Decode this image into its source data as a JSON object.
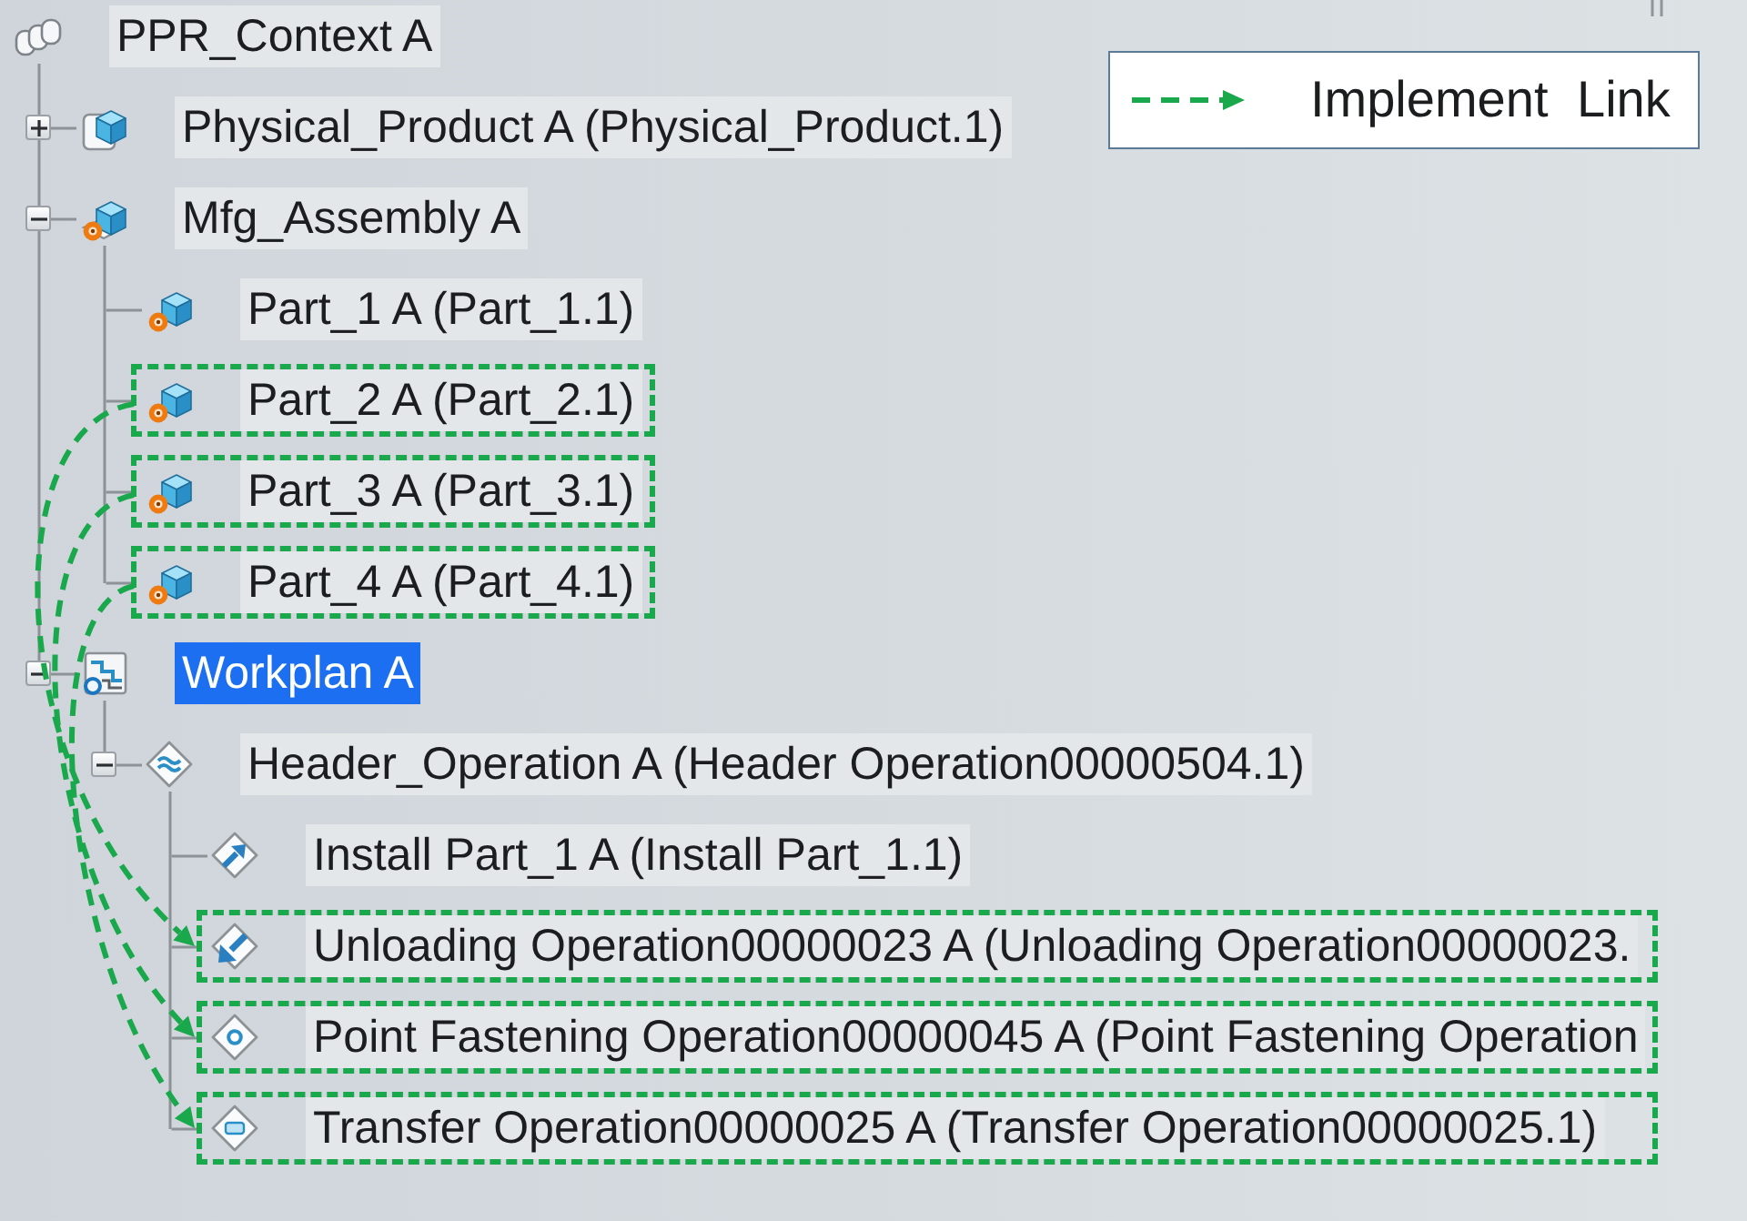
{
  "tree": {
    "nodes": [
      {
        "label": "PPR_Context A",
        "kind": "context",
        "selected": false,
        "children": [
          {
            "label": "Physical_Product A (Physical_Product.1)",
            "kind": "product",
            "expanded": false,
            "selected": false
          },
          {
            "label": "Mfg_Assembly A",
            "kind": "assembly",
            "expanded": true,
            "selected": false,
            "children": [
              {
                "label": "Part_1 A (Part_1.1)",
                "kind": "part",
                "selected": false,
                "link_source": false
              },
              {
                "label": "Part_2 A (Part_2.1)",
                "kind": "part",
                "selected": false,
                "link_source": true
              },
              {
                "label": "Part_3 A (Part_3.1)",
                "kind": "part",
                "selected": false,
                "link_source": true
              },
              {
                "label": "Part_4 A (Part_4.1)",
                "kind": "part",
                "selected": false,
                "link_source": true
              }
            ]
          },
          {
            "label": "Workplan A",
            "kind": "workplan",
            "expanded": true,
            "selected": true,
            "children": [
              {
                "label": "Header_Operation A (Header Operation00000504.1)",
                "kind": "header_operation",
                "expanded": true,
                "selected": false,
                "children": [
                  {
                    "label": "Install Part_1 A (Install Part_1.1)",
                    "kind": "install",
                    "selected": false,
                    "link_target": false
                  },
                  {
                    "label": "Unloading Operation00000023 A (Unloading Operation00000023.",
                    "kind": "unloading",
                    "selected": false,
                    "link_target": true
                  },
                  {
                    "label": "Point Fastening Operation00000045 A (Point Fastening Operation",
                    "kind": "point_fastening",
                    "selected": false,
                    "link_target": true
                  },
                  {
                    "label": "Transfer Operation00000025 A (Transfer Operation00000025.1)",
                    "kind": "transfer",
                    "selected": false,
                    "link_target": true
                  }
                ]
              }
            ]
          }
        ]
      }
    ]
  },
  "legend": {
    "label": "Implement Link"
  }
}
